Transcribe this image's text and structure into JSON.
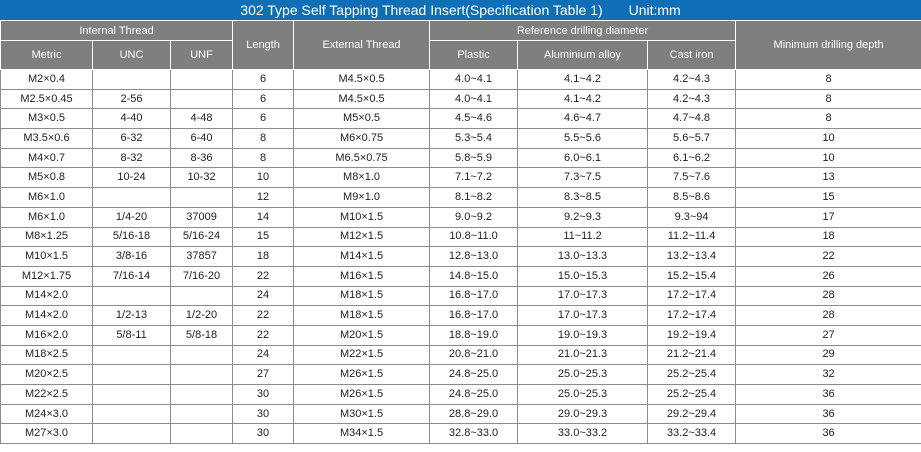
{
  "title": {
    "text": "302 Type Self Tapping Thread Insert(Specification Table 1)",
    "unit": "Unit:mm"
  },
  "headers": {
    "internal_thread": "Internal Thread",
    "length": "Length",
    "external_thread": "External Thread",
    "reference_drilling_diameter": "Reference drilling diameter",
    "minimum_drilling_depth": "Minimum drilling depth",
    "metric": "Metric",
    "unc": "UNC",
    "unf": "UNF",
    "plastic": "Plastic",
    "aluminium_alloy": "Aluminium alloy",
    "cast_iron": "Cast iron"
  },
  "rows": [
    [
      "M2×0.4",
      "",
      "",
      "6",
      "M4.5×0.5",
      "4.0~4.1",
      "4.1~4.2",
      "4.2~4.3",
      "8"
    ],
    [
      "M2.5×0.45",
      "2-56",
      "",
      "6",
      "M4.5×0.5",
      "4.0~4.1",
      "4.1~4.2",
      "4.2~4.3",
      "8"
    ],
    [
      "M3×0.5",
      "4-40",
      "4-48",
      "6",
      "M5×0.5",
      "4.5~4.6",
      "4.6~4.7",
      "4.7~4.8",
      "8"
    ],
    [
      "M3.5×0.6",
      "6-32",
      "6-40",
      "8",
      "M6×0.75",
      "5.3~5.4",
      "5.5~5.6",
      "5.6~5.7",
      "10"
    ],
    [
      "M4×0.7",
      "8-32",
      "8-36",
      "8",
      "M6.5×0.75",
      "5.8~5.9",
      "6.0~6.1",
      "6.1~6.2",
      "10"
    ],
    [
      "M5×0.8",
      "10-24",
      "10-32",
      "10",
      "M8×1.0",
      "7.1~7.2",
      "7.3~7.5",
      "7.5~7.6",
      "13"
    ],
    [
      "M6×1.0",
      "",
      "",
      "12",
      "M9×1.0",
      "8.1~8.2",
      "8.3~8.5",
      "8.5~8.6",
      "15"
    ],
    [
      "M6×1.0",
      "1/4-20",
      "37009",
      "14",
      "M10×1.5",
      "9.0~9.2",
      "9.2~9.3",
      "9.3~94",
      "17"
    ],
    [
      "M8×1.25",
      "5/16-18",
      "5/16-24",
      "15",
      "M12×1.5",
      "10.8~11.0",
      "11~11.2",
      "11.2~11.4",
      "18"
    ],
    [
      "M10×1.5",
      "3/8-16",
      "37857",
      "18",
      "M14×1.5",
      "12.8~13.0",
      "13.0~13.3",
      "13.2~13.4",
      "22"
    ],
    [
      "M12×1.75",
      "7/16-14",
      "7/16-20",
      "22",
      "M16×1.5",
      "14.8~15.0",
      "15.0~15.3",
      "15.2~15.4",
      "26"
    ],
    [
      "M14×2.0",
      "",
      "",
      "24",
      "M18×1.5",
      "16.8~17.0",
      "17.0~17.3",
      "17.2~17.4",
      "28"
    ],
    [
      "M14×2.0",
      "1/2-13",
      "1/2-20",
      "22",
      "M18×1.5",
      "16.8~17.0",
      "17.0~17.3",
      "17.2~17.4",
      "28"
    ],
    [
      "M16×2.0",
      "5/8-11",
      "5/8-18",
      "22",
      "M20×1.5",
      "18.8~19.0",
      "19.0~19.3",
      "19.2~19.4",
      "27"
    ],
    [
      "M18×2.5",
      "",
      "",
      "24",
      "M22×1.5",
      "20.8~21.0",
      "21.0~21.3",
      "21.2~21.4",
      "29"
    ],
    [
      "M20×2.5",
      "",
      "",
      "27",
      "M26×1.5",
      "24.8~25.0",
      "25.0~25.3",
      "25.2~25.4",
      "32"
    ],
    [
      "M22×2.5",
      "",
      "",
      "30",
      "M26×1.5",
      "24.8~25.0",
      "25.0~25.3",
      "25.2~25.4",
      "36"
    ],
    [
      "M24×3.0",
      "",
      "",
      "30",
      "M30×1.5",
      "28.8~29.0",
      "29.0~29.3",
      "29.2~29.4",
      "36"
    ],
    [
      "M27×3.0",
      "",
      "",
      "30",
      "M34×1.5",
      "32.8~33.0",
      "33.0~33.2",
      "33.2~33.4",
      "36"
    ]
  ]
}
